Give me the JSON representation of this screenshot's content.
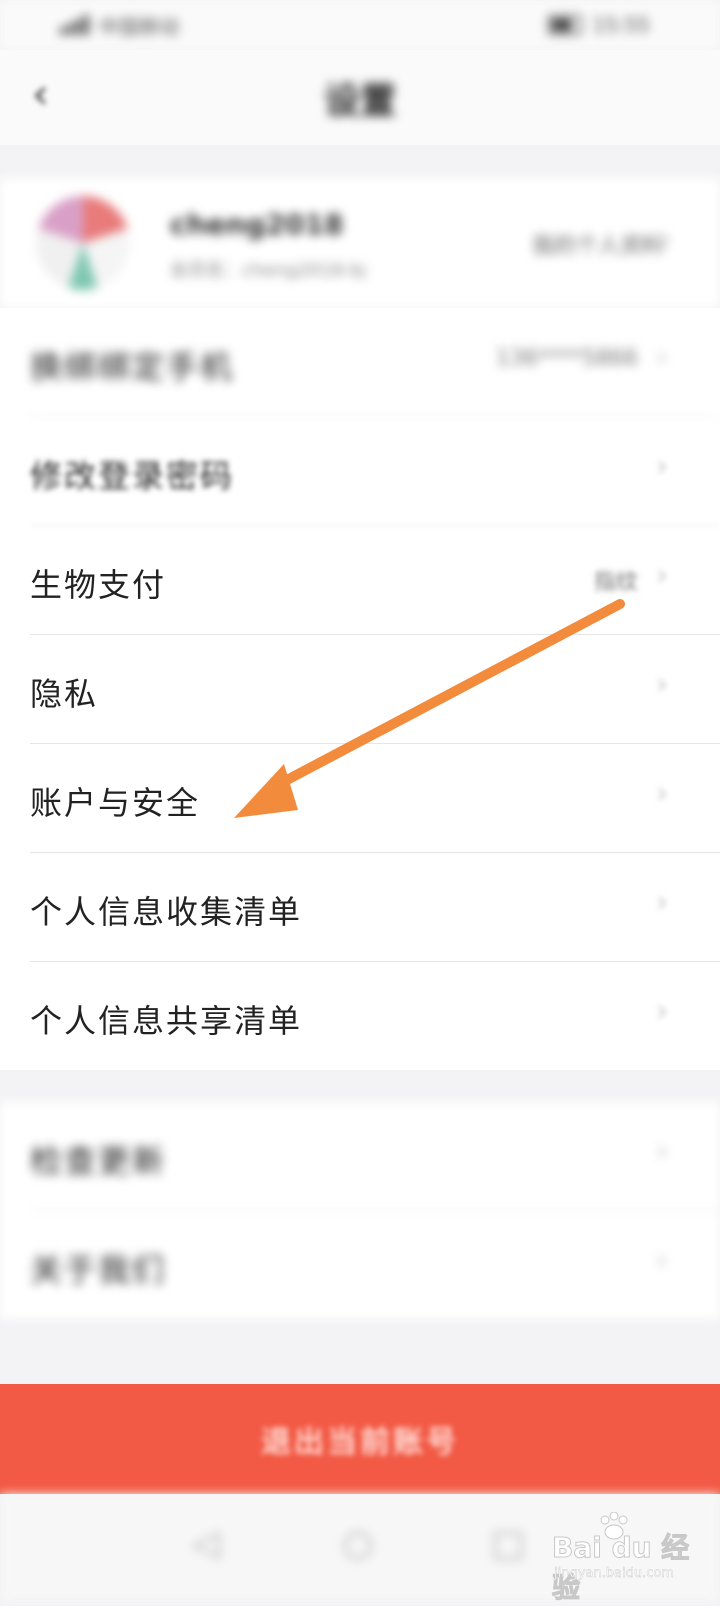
{
  "status_bar": {
    "carrier": "中国移动",
    "time": "15:55",
    "icons": [
      "signal-icon",
      "wifi-icon",
      "battery-icon"
    ]
  },
  "header": {
    "title": "设置",
    "back_icon": "chevron-left-icon"
  },
  "profile": {
    "name": "cheng2018",
    "subtitle": "会员名：cheng2018-bj",
    "link": "我的个人资料"
  },
  "settings": {
    "items": [
      {
        "label": "换绑绑定手机",
        "value": "136****5866"
      },
      {
        "label": "修改登录密码",
        "value": ""
      },
      {
        "label": "生物支付",
        "value": "指纹"
      },
      {
        "label": "隐私",
        "value": ""
      },
      {
        "label": "账户与安全",
        "value": ""
      },
      {
        "label": "个人信息收集清单",
        "value": ""
      },
      {
        "label": "个人信息共享清单",
        "value": ""
      }
    ],
    "items_2": [
      {
        "label": "检查更新",
        "value": ""
      },
      {
        "label": "关于我们",
        "value": ""
      }
    ]
  },
  "logout_button": "退出当前账号",
  "colors": {
    "accent_red": "#f25a45",
    "annotation_orange": "#f38b3c"
  },
  "watermark": {
    "main": "Bai du 经验",
    "sub": "jingyan.baidu.com"
  }
}
